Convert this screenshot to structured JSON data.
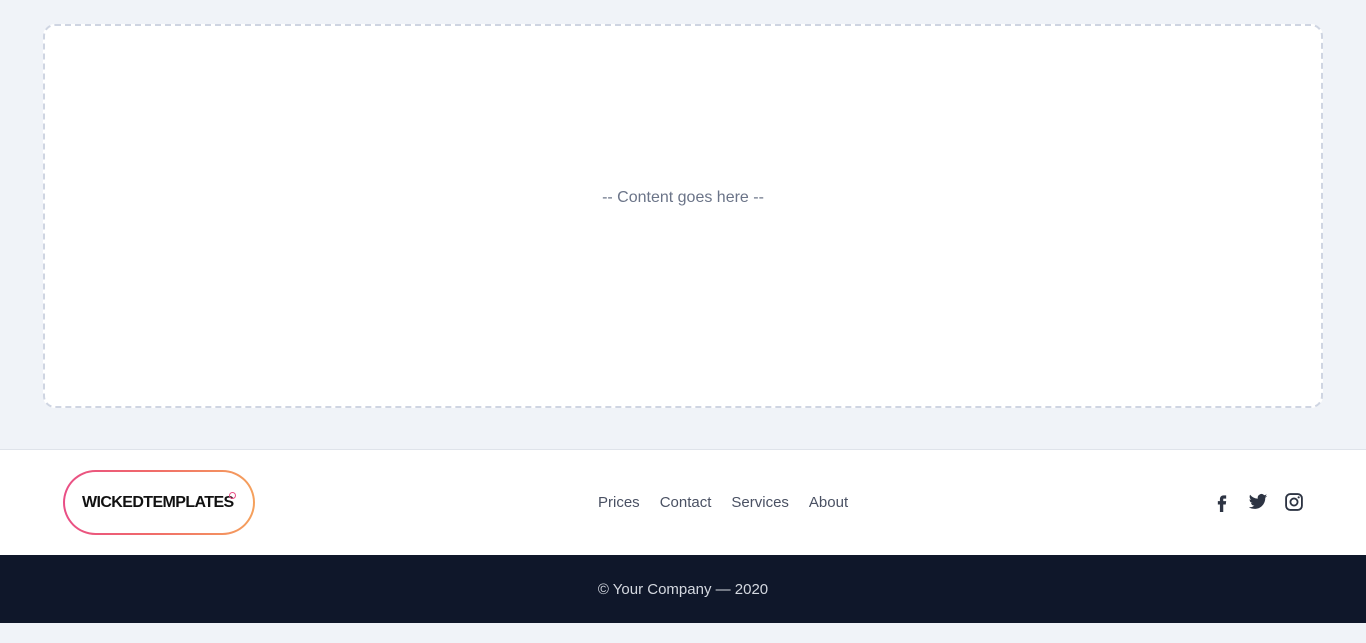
{
  "main": {
    "placeholder": "-- Content goes here --"
  },
  "footer": {
    "logo": {
      "text": "WICKEDTEMPLATES",
      "gradient_colors": [
        "#e94e86",
        "#f06a6a",
        "#f5a15c"
      ]
    },
    "nav": [
      {
        "label": "Prices"
      },
      {
        "label": "Contact"
      },
      {
        "label": "Services"
      },
      {
        "label": "About"
      }
    ],
    "social": [
      {
        "icon": "facebook-icon"
      },
      {
        "icon": "twitter-icon"
      },
      {
        "icon": "instagram-icon"
      }
    ]
  },
  "copyright": {
    "text": "© Your Company — 2020"
  },
  "colors": {
    "page_background": "#f0f3f8",
    "copyright_background": "#0f172a",
    "nav_text": "#4a5163"
  }
}
